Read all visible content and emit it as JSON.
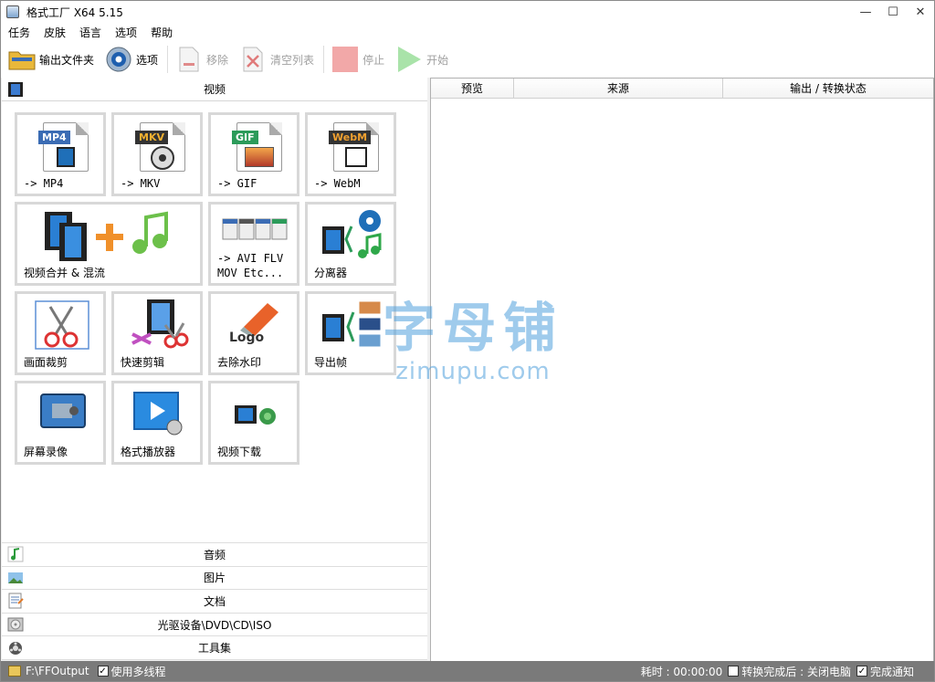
{
  "window": {
    "title": "格式工厂 X64 5.15",
    "controls": {
      "minimize": "—",
      "maximize": "☐",
      "close": "✕"
    }
  },
  "menu": [
    "任务",
    "皮肤",
    "语言",
    "选项",
    "帮助"
  ],
  "toolbar": {
    "output_folder": "输出文件夹",
    "options": "选项",
    "remove": "移除",
    "clear_list": "清空列表",
    "stop": "停止",
    "start": "开始"
  },
  "video_section": {
    "title": "视频",
    "tiles": [
      {
        "label": "-> MP4",
        "badge": "MP4",
        "badge_color": "#3b6cb4"
      },
      {
        "label": "-> MKV",
        "badge": "MKV",
        "badge_color": "#333333"
      },
      {
        "label": "-> GIF",
        "badge": "GIF",
        "badge_color": "#2c9b5a"
      },
      {
        "label": "-> WebM",
        "badge": "WebM",
        "badge_color": "#333333"
      },
      {
        "label": "视频合并 & 混流"
      },
      {
        "label": "-> AVI FLV\nMOV Etc..."
      },
      {
        "label": "分离器"
      },
      {
        "label": "画面裁剪"
      },
      {
        "label": "快速剪辑"
      },
      {
        "label": "去除水印",
        "logo_text": "Logo"
      },
      {
        "label": "导出帧"
      },
      {
        "label": "屏幕录像"
      },
      {
        "label": "格式播放器"
      },
      {
        "label": "视频下载"
      }
    ]
  },
  "categories": [
    "音频",
    "图片",
    "文档",
    "光驱设备\\DVD\\CD\\ISO",
    "工具集"
  ],
  "task_table": {
    "columns": [
      "预览",
      "来源",
      "输出 / 转换状态"
    ]
  },
  "watermark": {
    "line1": "字母铺",
    "line2": "zimupu.com"
  },
  "statusbar": {
    "output_path": "F:\\FFOutput",
    "multithread": "使用多线程",
    "elapsed": "耗时 : 00:00:00",
    "after_convert": "转换完成后 : 关闭电脑",
    "notify": "完成通知"
  }
}
